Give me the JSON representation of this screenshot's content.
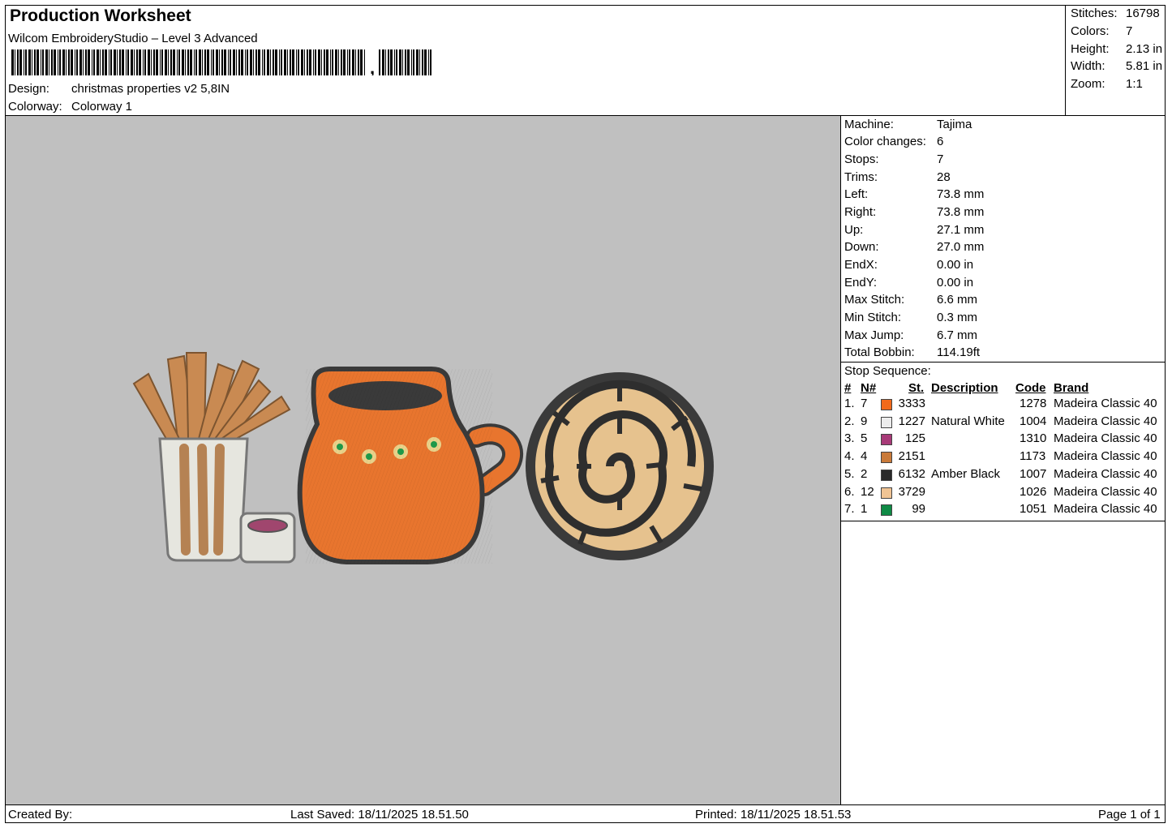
{
  "header": {
    "title": "Production Worksheet",
    "software": "Wilcom EmbroideryStudio – Level 3 Advanced",
    "barcode_suffix": ",",
    "design_label": "Design:",
    "design_value": "christmas properties v2 5,8IN",
    "colorway_label": "Colorway:",
    "colorway_value": "Colorway 1"
  },
  "stats": [
    {
      "label": "Stitches:",
      "value": "16798"
    },
    {
      "label": "Colors:",
      "value": "7"
    },
    {
      "label": "Height:",
      "value": "2.13 in"
    },
    {
      "label": "Width:",
      "value": "5.81 in"
    },
    {
      "label": "Zoom:",
      "value": "1:1"
    }
  ],
  "properties": [
    {
      "label": "Machine:",
      "value": "Tajima"
    },
    {
      "label": "Color changes:",
      "value": "6"
    },
    {
      "label": "Stops:",
      "value": "7"
    },
    {
      "label": "Trims:",
      "value": "28"
    },
    {
      "label": "Left:",
      "value": "73.8 mm"
    },
    {
      "label": "Right:",
      "value": "73.8 mm"
    },
    {
      "label": "Up:",
      "value": "27.1 mm"
    },
    {
      "label": "Down:",
      "value": "27.0 mm"
    },
    {
      "label": "EndX:",
      "value": "0.00 in"
    },
    {
      "label": "EndY:",
      "value": "0.00 in"
    },
    {
      "label": "Max Stitch:",
      "value": "6.6 mm"
    },
    {
      "label": "Min Stitch:",
      "value": "0.3 mm"
    },
    {
      "label": "Max Jump:",
      "value": "6.7 mm"
    },
    {
      "label": "Total Bobbin:",
      "value": "114.19ft"
    }
  ],
  "stop_sequence": {
    "title": "Stop Sequence:",
    "headers": {
      "idx": "#",
      "n": "N#",
      "st": "St.",
      "desc": "Description",
      "code": "Code",
      "brand": "Brand"
    },
    "rows": [
      {
        "idx": "1.",
        "n": "7",
        "color": "#f26a1b",
        "st": "3333",
        "desc": "",
        "code": "1278",
        "brand": "Madeira Classic 40"
      },
      {
        "idx": "2.",
        "n": "9",
        "color": "#ececec",
        "st": "1227",
        "desc": "Natural White",
        "code": "1004",
        "brand": "Madeira Classic 40"
      },
      {
        "idx": "3.",
        "n": "5",
        "color": "#a83a78",
        "st": "125",
        "desc": "",
        "code": "1310",
        "brand": "Madeira Classic 40"
      },
      {
        "idx": "4.",
        "n": "4",
        "color": "#c97a3a",
        "st": "2151",
        "desc": "",
        "code": "1173",
        "brand": "Madeira Classic 40"
      },
      {
        "idx": "5.",
        "n": "2",
        "color": "#2a2a2a",
        "st": "6132",
        "desc": "Amber Black",
        "code": "1007",
        "brand": "Madeira Classic 40"
      },
      {
        "idx": "6.",
        "n": "12",
        "color": "#f0c494",
        "st": "3729",
        "desc": "",
        "code": "1026",
        "brand": "Madeira Classic 40"
      },
      {
        "idx": "7.",
        "n": "1",
        "color": "#0f8a45",
        "st": "99",
        "desc": "",
        "code": "1051",
        "brand": "Madeira Classic 40"
      }
    ]
  },
  "footer": {
    "created_by": "Created By:",
    "last_saved": "Last Saved: 18/11/2025 18.51.50",
    "printed": "Printed: 18/11/2025 18.51.53",
    "page": "Page 1 of 1"
  },
  "colors": {
    "canvas_bg": "#c0c0c0",
    "churro": "#c98a52",
    "glass": "#e6e6df",
    "mug": "#e8752e",
    "outline": "#3a3a3a",
    "bread": "#e6c28e",
    "sauce": "#a0466e",
    "flower_petal": "#e9d28a",
    "flower_center": "#1f9a4a"
  },
  "design_items": [
    {
      "icon": "churros-glass-icon"
    },
    {
      "icon": "clay-mug-icon"
    },
    {
      "icon": "spiral-bread-icon"
    }
  ]
}
